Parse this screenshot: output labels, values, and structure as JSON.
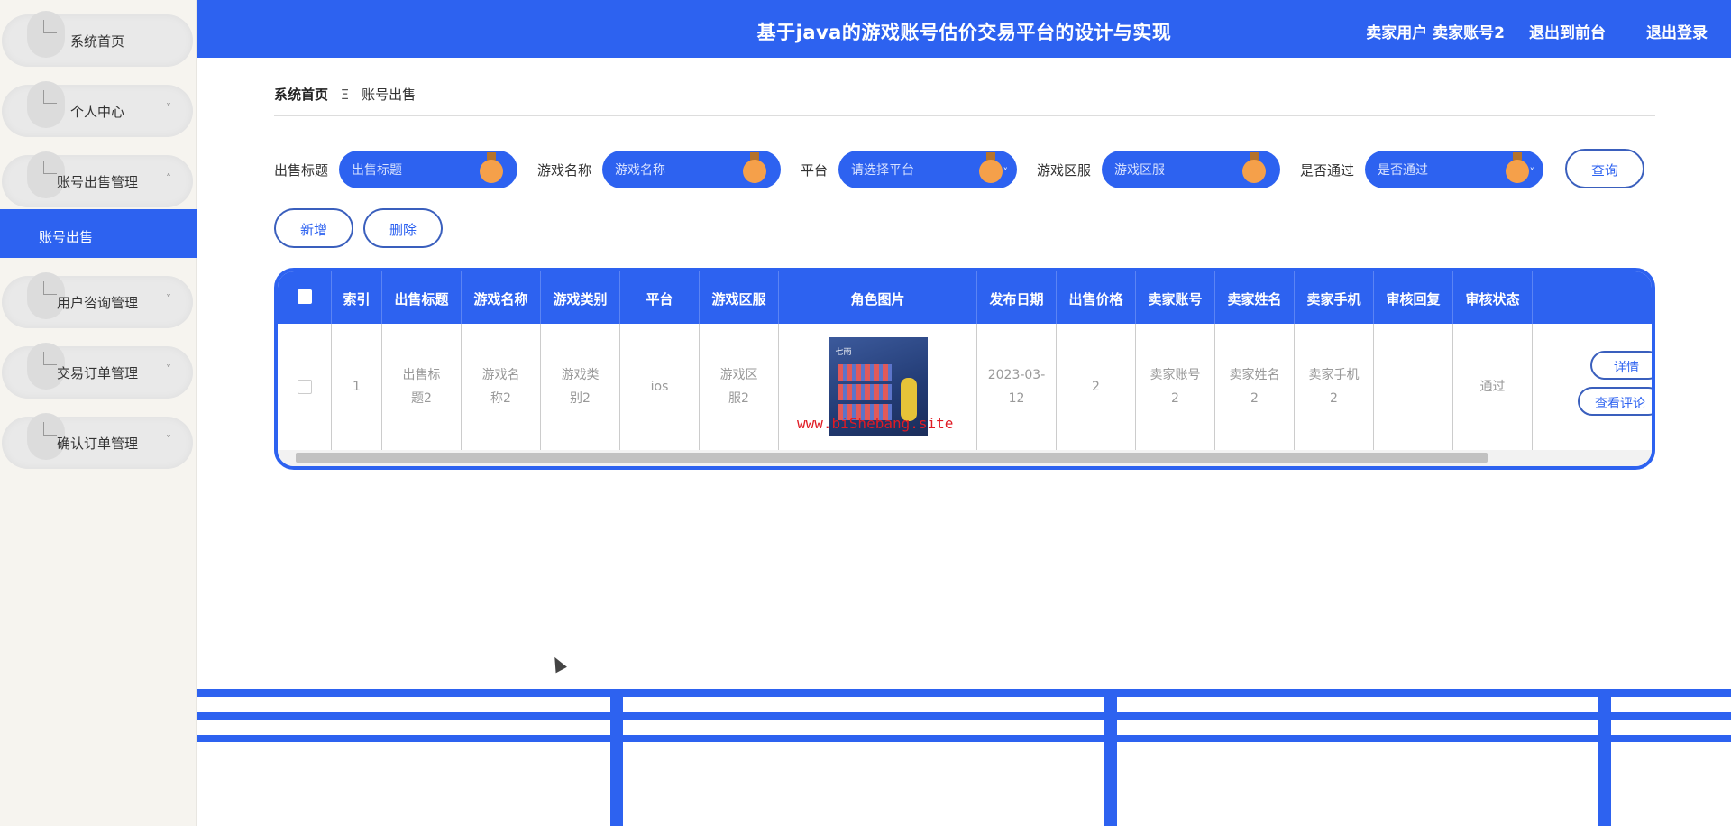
{
  "topbar": {
    "title": "基于java的游戏账号估价交易平台的设计与实现",
    "user": "卖家用户 卖家账号2",
    "front_link": "退出到前台",
    "logout_link": "退出登录"
  },
  "sidebar": {
    "items": [
      {
        "label": "系统首页"
      },
      {
        "label": "个人中心",
        "chevron": "˅"
      },
      {
        "label": "账号出售管理",
        "chevron": "˄"
      },
      {
        "label": "用户咨询管理",
        "chevron": "˅"
      },
      {
        "label": "交易订单管理",
        "chevron": "˅"
      },
      {
        "label": "确认订单管理",
        "chevron": "˅"
      }
    ],
    "active_sub": "账号出售"
  },
  "breadcrumb": {
    "home": "系统首页",
    "sep": "Ξ",
    "current": "账号出售"
  },
  "filters": [
    {
      "label": "出售标题",
      "placeholder": "出售标题"
    },
    {
      "label": "游戏名称",
      "placeholder": "游戏名称"
    },
    {
      "label": "平台",
      "placeholder": "请选择平台"
    },
    {
      "label": "游戏区服",
      "placeholder": "游戏区服"
    },
    {
      "label": "是否通过",
      "placeholder": "是否通过"
    }
  ],
  "buttons": {
    "search": "查询",
    "add": "新增",
    "delete": "删除"
  },
  "table": {
    "headers": [
      "索引",
      "出售标题",
      "游戏名称",
      "游戏类别",
      "平台",
      "游戏区服",
      "角色图片",
      "发布日期",
      "出售价格",
      "卖家账号",
      "卖家姓名",
      "卖家手机",
      "审核回复",
      "审核状态"
    ],
    "rows": [
      {
        "index": "1",
        "title": "出售标题2",
        "game_name": "游戏名称2",
        "game_type": "游戏类别2",
        "platform": "ios",
        "server": "游戏区服2",
        "date": "2023-03-12",
        "price": "2",
        "seller_account": "卖家账号2",
        "seller_name": "卖家姓名2",
        "seller_phone": "卖家手机2",
        "review_reply": "",
        "review_status": "通过",
        "actions": {
          "detail": "详情",
          "comments": "查看评论"
        }
      }
    ],
    "watermark": "www.biShebang.site",
    "thumb_label": "七雨"
  },
  "colors": {
    "primary": "#2d62f0",
    "knob": "#f5a04a",
    "watermark": "#e01b24"
  }
}
